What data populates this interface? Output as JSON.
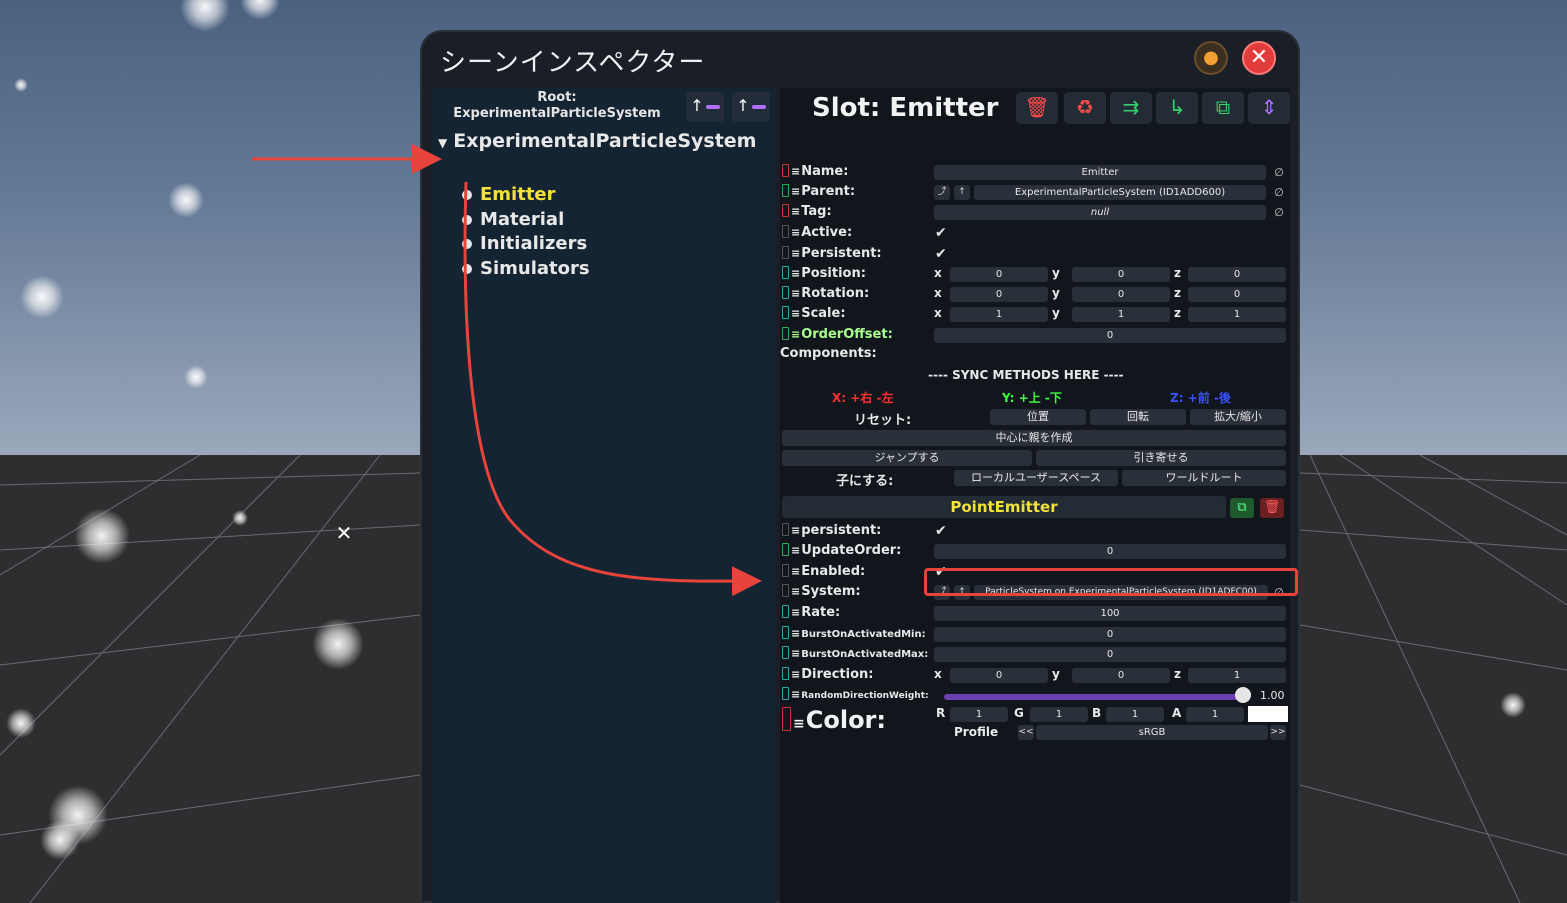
{
  "window": {
    "title": "シーンインスペクター",
    "pin_icon": "pin-icon",
    "close_icon": "close-icon"
  },
  "hierarchy": {
    "root_label": "Root:",
    "root_name": "ExperimentalParticleSystem",
    "tree_root": "ExperimentalParticleSystem",
    "children": [
      "Emitter",
      "Material",
      "Initializers",
      "Simulators"
    ],
    "selected": "Emitter"
  },
  "inspector": {
    "slot_title": "Slot: Emitter",
    "fields": {
      "name_label": "Name:",
      "name_value": "Emitter",
      "parent_label": "Parent:",
      "parent_value": "ExperimentalParticleSystem (ID1ADD600)",
      "tag_label": "Tag:",
      "tag_value": "null",
      "active_label": "Active:",
      "persistent_label": "Persistent:",
      "position_label": "Position:",
      "position": [
        "0",
        "0",
        "0"
      ],
      "rotation_label": "Rotation:",
      "rotation": [
        "0",
        "0",
        "0"
      ],
      "scale_label": "Scale:",
      "scale": [
        "1",
        "1",
        "1"
      ],
      "orderoffset_label": "OrderOffset:",
      "orderoffset_value": "0",
      "components_label": "Components:"
    },
    "axes": {
      "x": "x",
      "y": "y",
      "z": "z"
    },
    "sync": {
      "header": "---- SYNC METHODS HERE ----",
      "x_hint": "X: +右 -左",
      "y_hint": "Y: +上 -下",
      "z_hint": "Z: +前 -後",
      "reset_label": "リセット:",
      "reset_position": "位置",
      "reset_rotation": "回転",
      "reset_scale": "拡大/縮小",
      "create_parent": "中心に親を作成",
      "jump": "ジャンプする",
      "pull": "引き寄せる",
      "child_of_label": "子にする:",
      "local_user_space": "ローカルユーザースペース",
      "world_root": "ワールドルート"
    },
    "component": {
      "name": "PointEmitter",
      "persistent_label": "persistent:",
      "updateorder_label": "UpdateOrder:",
      "updateorder_value": "0",
      "enabled_label": "Enabled:",
      "system_label": "System:",
      "system_value": "ParticleSystem on ExperimentalParticleSystem (ID1ADFC00)",
      "rate_label": "Rate:",
      "rate_value": "100",
      "burstmin_label": "BurstOnActivatedMin:",
      "burstmin_value": "0",
      "burstmax_label": "BurstOnActivatedMax:",
      "burstmax_value": "0",
      "direction_label": "Direction:",
      "direction": [
        "0",
        "0",
        "1"
      ],
      "rdw_label": "RandomDirectionWeight:",
      "rdw_value": "1.00",
      "rdw_fraction": 1.0,
      "color_label": "Color:",
      "color_channels": {
        "r_label": "R",
        "g_label": "G",
        "b_label": "B",
        "a_label": "A"
      },
      "color": [
        "1",
        "1",
        "1",
        "1"
      ],
      "swatch_color": "#ffffff",
      "profile_label": "Profile",
      "profile_value": "sRGB",
      "profile_prev": "<<",
      "profile_next": ">>"
    }
  },
  "colors": {
    "selected_text": "#f3e23a",
    "annotation_red": "#e8443c",
    "hint_x": "#ff3030",
    "hint_y": "#3cff3c",
    "hint_z": "#3a50ff"
  }
}
